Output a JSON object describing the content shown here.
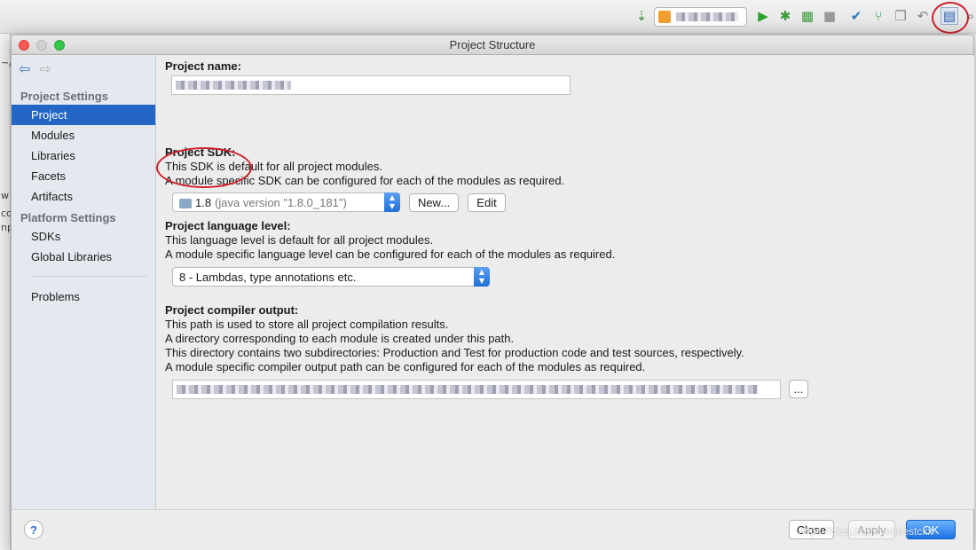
{
  "dialog": {
    "title": "Project Structure"
  },
  "sidebar": {
    "project_settings_header": "Project Settings",
    "project_settings_items": [
      {
        "label": "Project",
        "selected": true
      },
      {
        "label": "Modules"
      },
      {
        "label": "Libraries"
      },
      {
        "label": "Facets"
      },
      {
        "label": "Artifacts"
      }
    ],
    "platform_settings_header": "Platform Settings",
    "platform_settings_items": [
      {
        "label": "SDKs"
      },
      {
        "label": "Global Libraries"
      }
    ],
    "problems_label": "Problems"
  },
  "project": {
    "name_label": "Project name:",
    "sdk_label": "Project SDK:",
    "sdk_desc_1": "This SDK is default for all project modules.",
    "sdk_desc_2": "A module specific SDK can be configured for each of the modules as required.",
    "sdk_version": "1.8",
    "sdk_detail": "(java version \"1.8.0_181\")",
    "sdk_new_button": "New...",
    "sdk_edit_button": "Edit",
    "language_label": "Project language level:",
    "language_desc_1": "This language level is default for all project modules.",
    "language_desc_2": "A module specific language level can be configured for each of the modules as required.",
    "language_value": "8 - Lambdas, type annotations etc.",
    "compiler_label": "Project compiler output:",
    "compiler_desc_1": "This path is used to store all project compilation results.",
    "compiler_desc_2": "A directory corresponding to each module is created under this path.",
    "compiler_desc_3": "This directory contains two subdirectories: Production and Test for production code and test sources, respectively.",
    "compiler_desc_4": "A module specific compiler output path can be configured for each of the modules as required.",
    "browse_button": "..."
  },
  "footer": {
    "help": "?",
    "close": "Close",
    "apply": "Apply",
    "ok": "OK"
  },
  "watermark": "https://blog.csdn.net/bestcxx",
  "ide_edge_text": [
    "~/",
    "w",
    "co",
    "np"
  ],
  "colors": {
    "selection": "#2366c6",
    "annotation_circle": "#d0202a",
    "ok_button": "#1c72e8"
  }
}
